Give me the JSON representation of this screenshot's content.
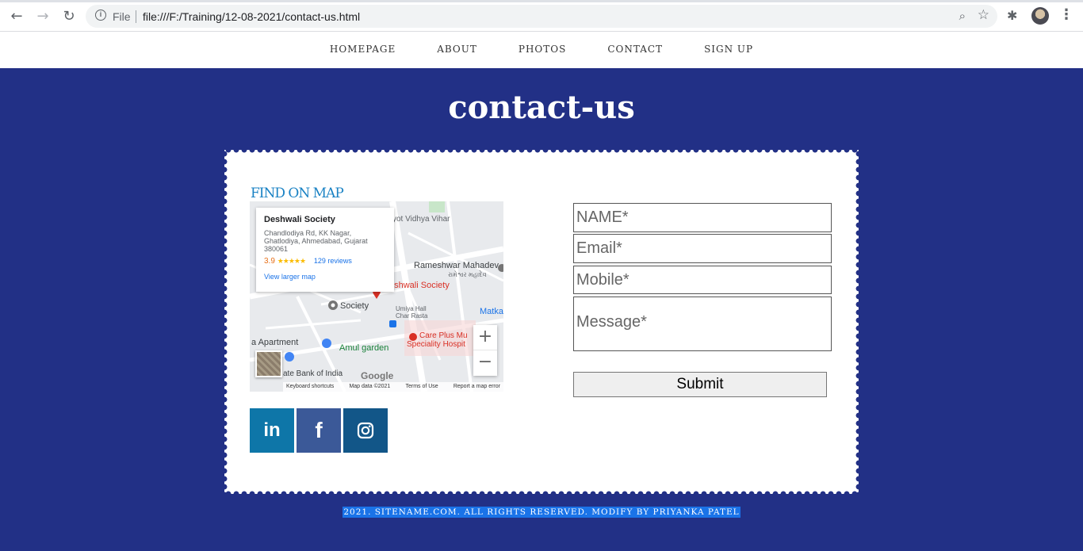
{
  "browser": {
    "file_label": "File",
    "url": "file:///F:/Training/12-08-2021/contact-us.html",
    "icons": [
      "back-icon",
      "forward-icon",
      "reload-icon",
      "info-icon",
      "zoom-icon",
      "star-icon",
      "extensions-icon",
      "profile-avatar",
      "menu-icon"
    ]
  },
  "nav": {
    "items": [
      "HOMEPAGE",
      "ABOUT",
      "PHOTOS",
      "CONTACT",
      "SIGN UP"
    ]
  },
  "page": {
    "title": "contact-us"
  },
  "map": {
    "section_title": "FIND ON MAP",
    "place_name": "Deshwali Society",
    "address": "Chandlodiya Rd, KK Nagar, Ghatlodiya, Ahmedabad, Gujarat 380061",
    "rating": "3.9",
    "stars": "★★★★★",
    "reviews": "129 reviews",
    "larger_map": "View larger map",
    "labels": {
      "vihar": "yot Vidhya Vihar",
      "mahadev": "Rameshwar Mahadev",
      "mahadev_gu": "રામેશ્વર મહાદેવ",
      "pin_label": "eshwali Society",
      "society": "Society",
      "umiya": "Umiya Hall",
      "char_rasta": "Char Rasta",
      "matka": "Matka",
      "apartment": "a Apartment",
      "amul": "Amul garden",
      "careplus1": "Care Plus Mu",
      "careplus2": "Speciality Hospit",
      "bank": "ate Bank of India"
    },
    "google": "Google",
    "footer": [
      "Keyboard shortcuts",
      "Map data ©2021",
      "Terms of Use",
      "Report a map error"
    ],
    "zoom_in": "+",
    "zoom_out": "−"
  },
  "social": [
    {
      "name": "linkedin",
      "glyph": "in",
      "color": "#0e76a8"
    },
    {
      "name": "facebook",
      "glyph": "f",
      "color": "#3b5998"
    },
    {
      "name": "instagram",
      "color": "#125688"
    }
  ],
  "form": {
    "name_placeholder": "NAME*",
    "email_placeholder": "Email*",
    "mobile_placeholder": "Mobile*",
    "message_placeholder": "Message*",
    "submit_label": "Submit"
  },
  "footer": {
    "text": "2021. SITENAME.COM. ALL RIGHTS RESERVED. MODIFY BY PRIYANKA PATEL"
  },
  "colors": {
    "background": "#223086",
    "accent": "#1a82c4"
  }
}
